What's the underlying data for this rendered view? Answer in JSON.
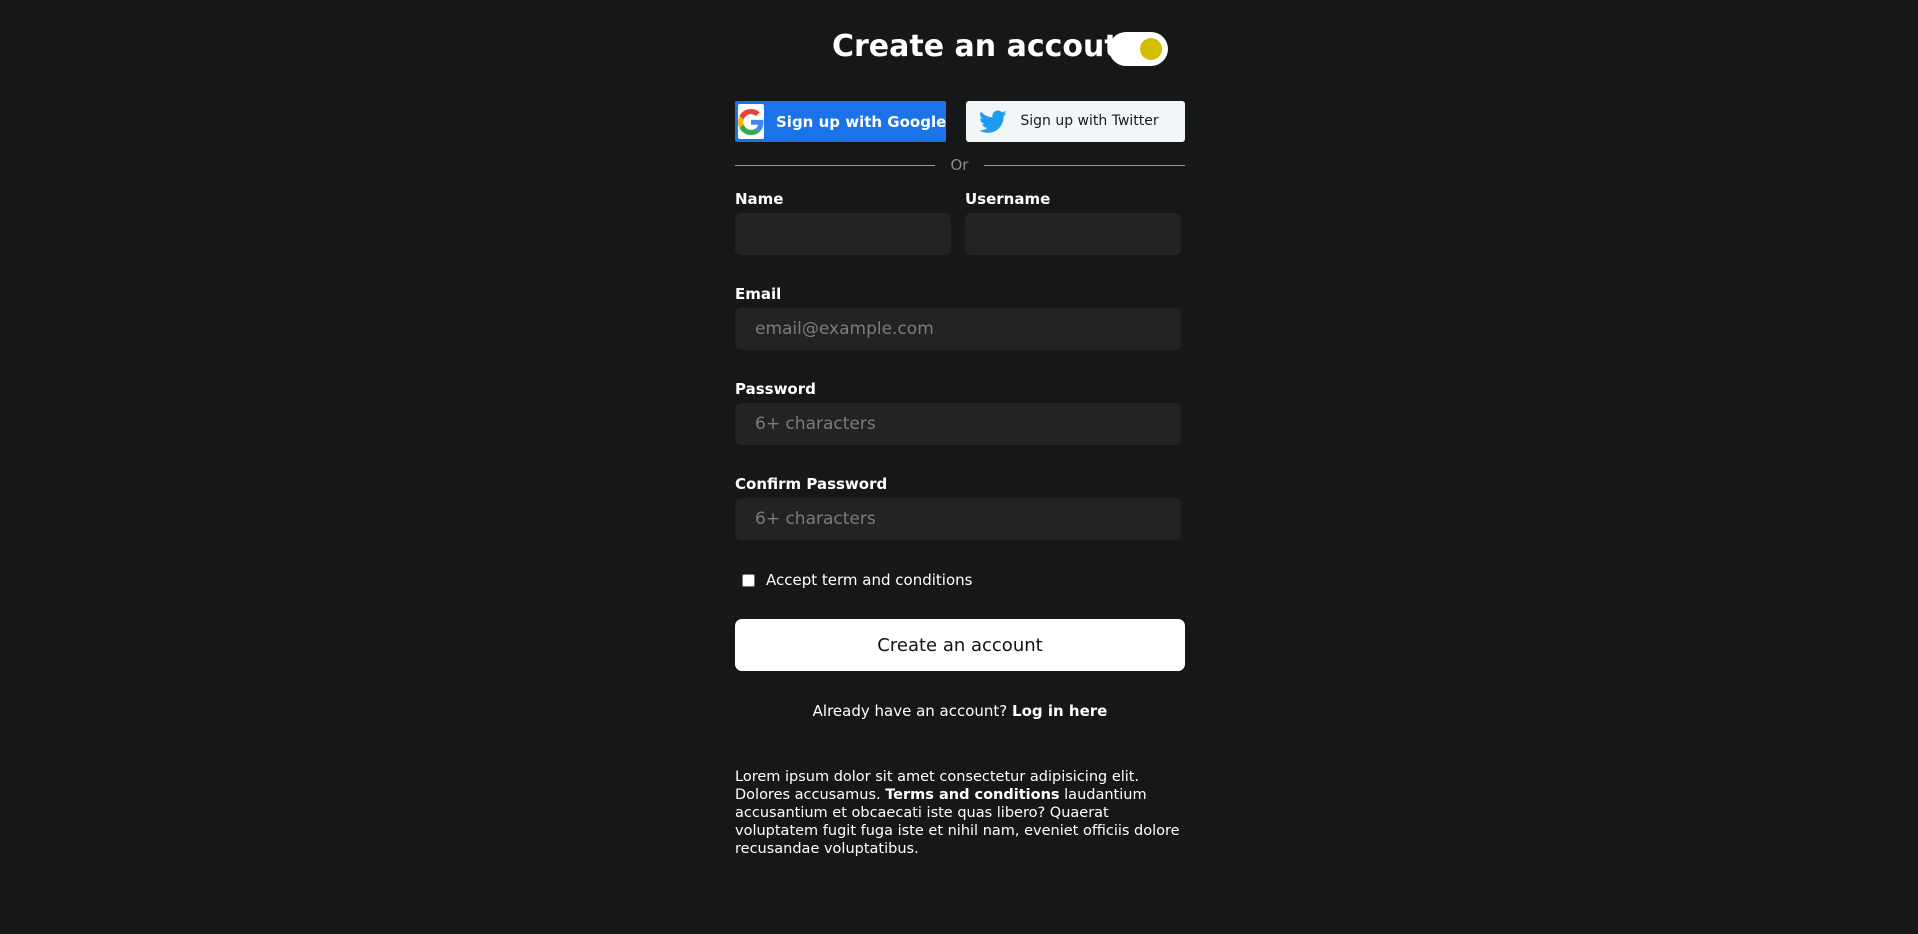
{
  "header": {
    "title": "Create an accout",
    "theme_toggle_state": "on"
  },
  "social": {
    "google_label": "Sign up with Google",
    "twitter_label": "Sign up with Twitter"
  },
  "divider": {
    "text": "Or"
  },
  "form": {
    "name_label": "Name",
    "name_value": "",
    "username_label": "Username",
    "username_value": "",
    "email_label": "Email",
    "email_placeholder": "email@example.com",
    "password_label": "Password",
    "password_placeholder": "6+ characters",
    "confirm_label": "Confirm Password",
    "confirm_placeholder": "6+ characters",
    "terms_checkbox_label": "Accept term and conditions",
    "terms_checked": false,
    "submit_label": "Create an account"
  },
  "login": {
    "prompt": "Already have an account?",
    "link_label": "Log in here"
  },
  "footer": {
    "text_before": "Lorem ipsum dolor sit amet consectetur adipisicing elit. Dolores accusamus.",
    "link_label": "Terms and conditions",
    "text_after": "laudantium accusantium et obcaecati iste quas libero? Quaerat voluptatem fugit fuga iste et nihil nam, eveniet officiis dolore recusandae voluptatibus."
  },
  "colors": {
    "background": "#161817",
    "google_blue": "#1a73e8",
    "twitter_blue": "#1d9bf0",
    "toggle_knob": "#d2c000",
    "input_bg": "#232323"
  },
  "icons": {
    "google": "google-logo-icon",
    "twitter": "twitter-bird-icon"
  }
}
